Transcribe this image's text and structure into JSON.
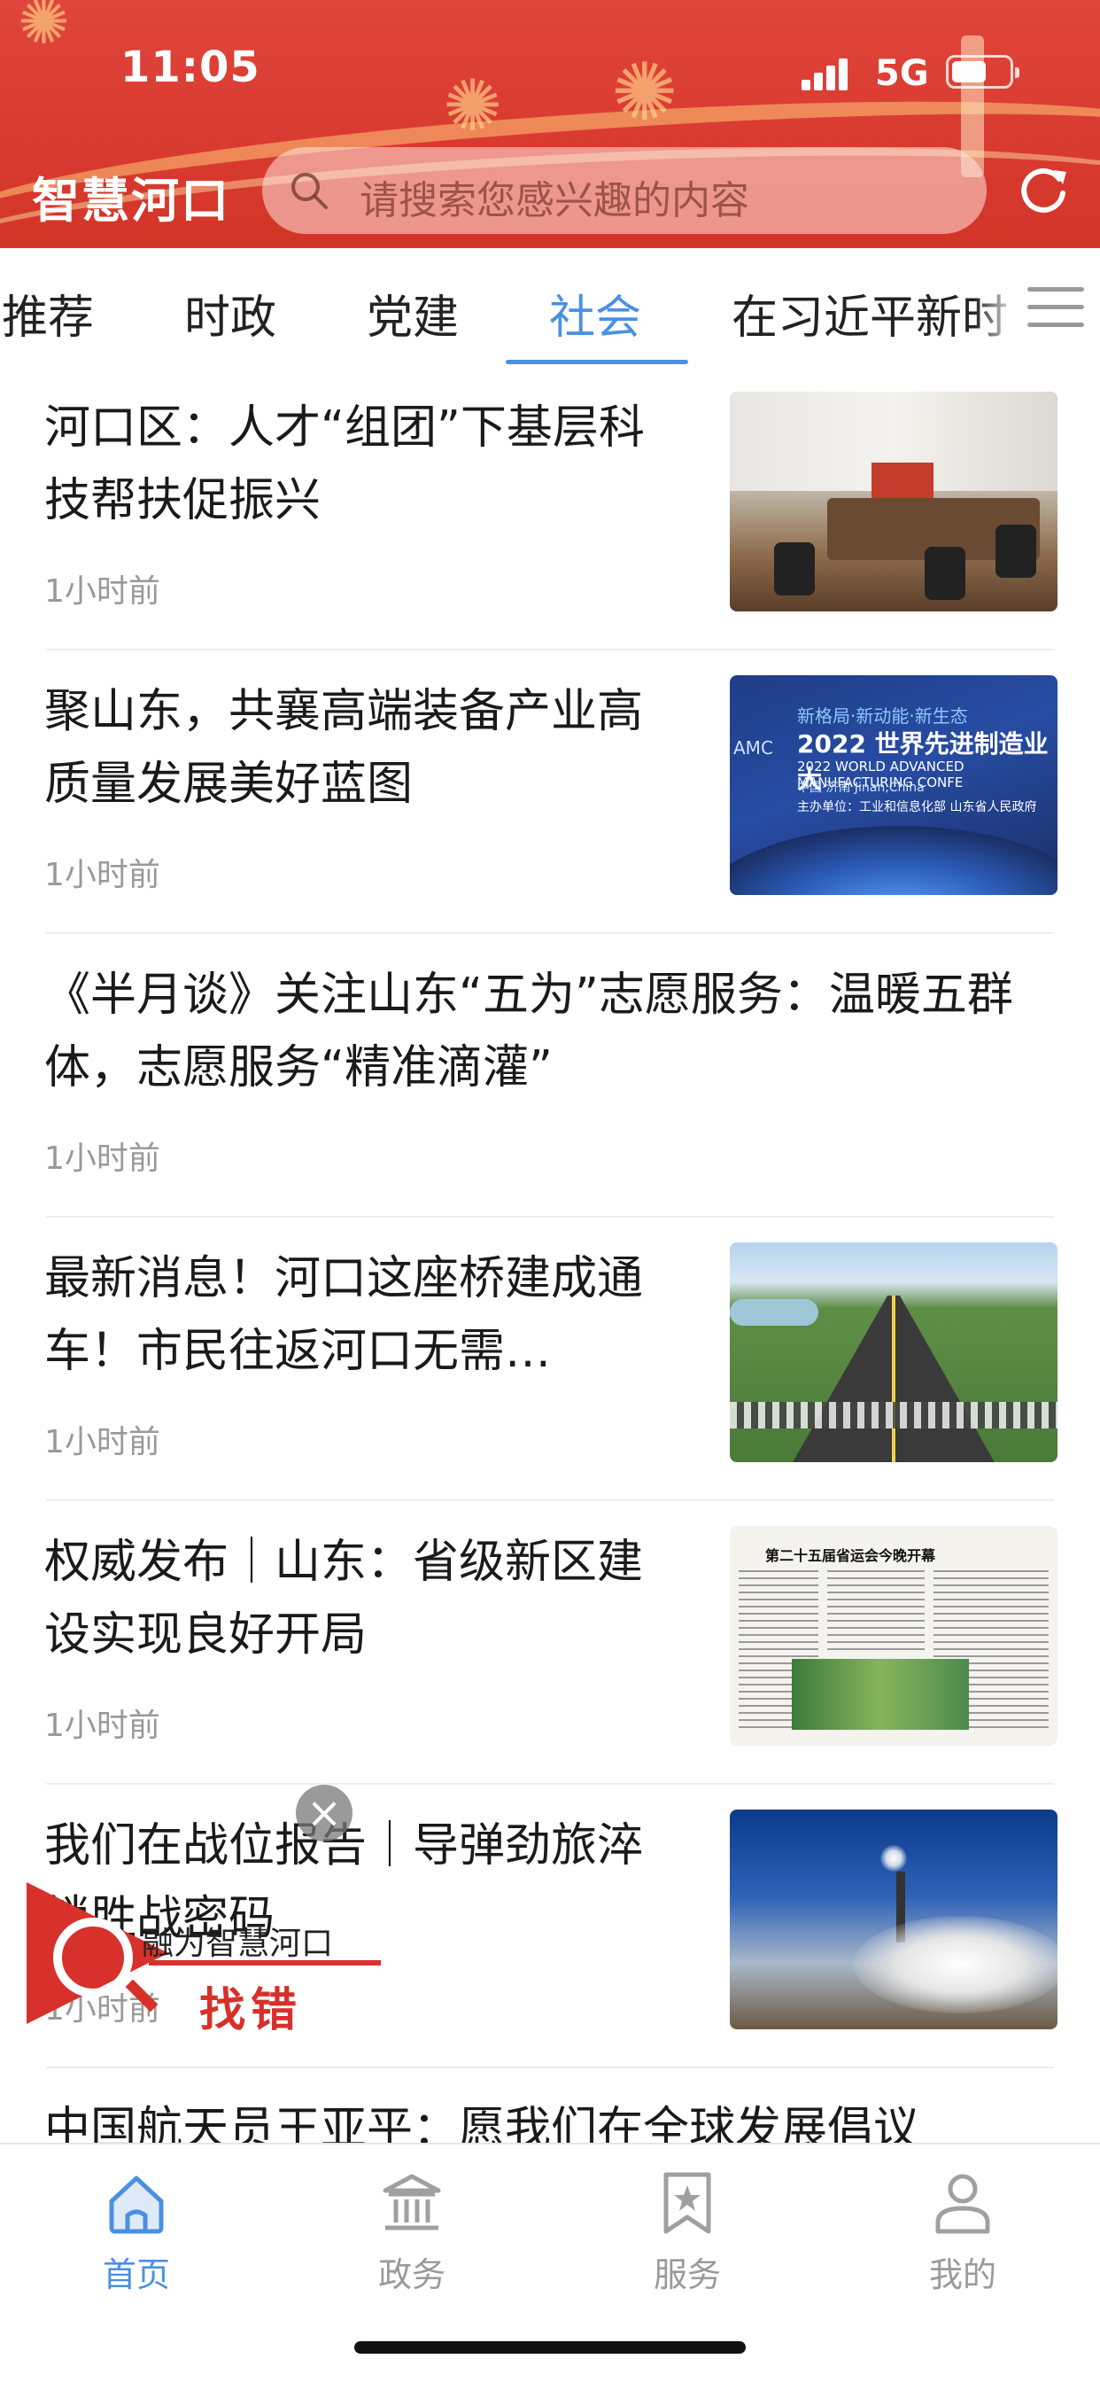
{
  "status_bar": {
    "time": "11:05",
    "network": "5G"
  },
  "header": {
    "app_title": "智慧河口",
    "search_placeholder": "请搜索您感兴趣的内容"
  },
  "tabs": [
    {
      "label": "推荐"
    },
    {
      "label": "时政"
    },
    {
      "label": "党建"
    },
    {
      "label": "社会",
      "active": true
    },
    {
      "label": "在习近平新时"
    }
  ],
  "feed": [
    {
      "title": "河口区：人才“组团”下基层科技帮扶促振兴",
      "time": "1小时前",
      "thumb": "meeting-photo"
    },
    {
      "title": "聚山东，共襄高端装备产业高质量发展美好蓝图",
      "time": "1小时前",
      "thumb": "expo-banner",
      "thumb_text": {
        "tag": "新格局·新动能·新生态",
        "headline": "2022 世界先进制造业大",
        "english": "2022 WORLD ADVANCED MANUFACTURING CONFE",
        "city": "中国·济南  Jinan,China",
        "host": "主办单位：工业和信息化部  山东省人民政府",
        "logo": "AMC"
      }
    },
    {
      "title": "《半月谈》关注山东“五为”志愿服务：温暖五群体，志愿服务“精准滴灌”",
      "time": "1小时前",
      "thumb": null
    },
    {
      "title": "最新消息！河口这座桥建成通车！市民往返河口无需…",
      "time": "1小时前",
      "thumb": "bridge-photo"
    },
    {
      "title": "权威发布｜山东：省级新区建设实现良好开局",
      "time": "1小时前",
      "thumb": "newspaper-page",
      "thumb_text": {
        "headline": "第二十五届省运会今晚开幕"
      }
    },
    {
      "title": "我们在战位报告｜导弹劲旅淬锁胜战密码",
      "time": "1小时前",
      "thumb": "missile-photo"
    },
    {
      "title": "中国航天员王亚平：愿我们在全球发展倡议",
      "time": "",
      "thumb": null
    }
  ],
  "overlay": {
    "brand": "融为智慧河口",
    "label": "找错",
    "close": "×"
  },
  "bottom_nav": [
    {
      "label": "首页",
      "icon": "home-icon",
      "active": true
    },
    {
      "label": "政务",
      "icon": "government-building-icon"
    },
    {
      "label": "服务",
      "icon": "bookmark-star-icon"
    },
    {
      "label": "我的",
      "icon": "user-icon"
    }
  ],
  "colors": {
    "header_red": "#d93a30",
    "accent_blue": "#4a90e2",
    "muted_gray": "#999999",
    "overlay_red": "#d8302b"
  }
}
